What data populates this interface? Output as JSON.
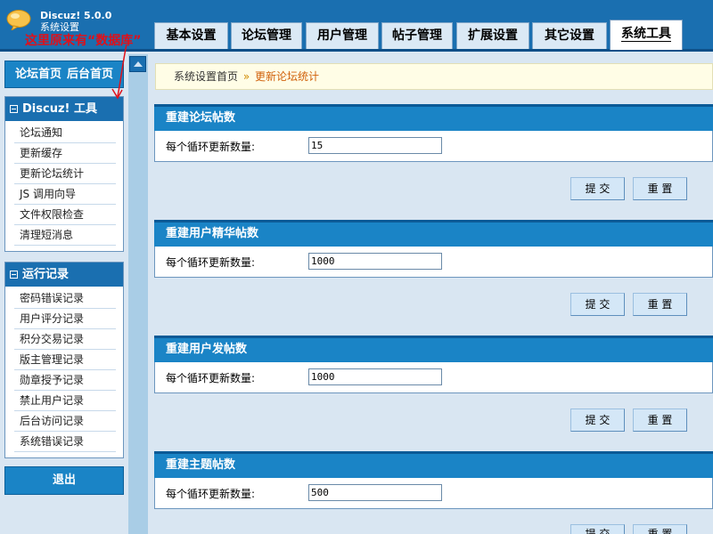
{
  "header": {
    "logo_title": "Discuz! 5.0.0",
    "logo_subtitle": "系统设置",
    "annotation": "这里原来有“数据库”",
    "tabs": [
      {
        "label": "基本设置",
        "active": false
      },
      {
        "label": "论坛管理",
        "active": false
      },
      {
        "label": "用户管理",
        "active": false
      },
      {
        "label": "帖子管理",
        "active": false
      },
      {
        "label": "扩展设置",
        "active": false
      },
      {
        "label": "其它设置",
        "active": false
      },
      {
        "label": "系统工具",
        "active": true
      }
    ]
  },
  "sidebar": {
    "top_links": {
      "forum_home": "论坛首页",
      "admin_home": "后台首页"
    },
    "tools_box": {
      "title": "Discuz! 工具",
      "items": [
        "论坛通知",
        "更新缓存",
        "更新论坛统计",
        "JS 调用向导",
        "文件权限检查",
        "清理短消息"
      ]
    },
    "logs_box": {
      "title": "运行记录",
      "items": [
        "密码错误记录",
        "用户评分记录",
        "积分交易记录",
        "版主管理记录",
        "勋章授予记录",
        "禁止用户记录",
        "后台访问记录",
        "系统错误记录"
      ]
    },
    "logout": "退出"
  },
  "breadcrumb": {
    "home": "系统设置首页",
    "separator": "»",
    "current": "更新论坛统计"
  },
  "sections": [
    {
      "title": "重建论坛帖数",
      "label": "每个循环更新数量:",
      "value": "15",
      "submit": "提 交",
      "reset": "重 置"
    },
    {
      "title": "重建用户精华帖数",
      "label": "每个循环更新数量:",
      "value": "1000",
      "submit": "提 交",
      "reset": "重 置"
    },
    {
      "title": "重建用户发帖数",
      "label": "每个循环更新数量:",
      "value": "1000",
      "submit": "提 交",
      "reset": "重 置"
    },
    {
      "title": "重建主题帖数",
      "label": "每个循环更新数量:",
      "value": "500",
      "submit": "提 交",
      "reset": "重 置"
    }
  ],
  "colors": {
    "header": "#1a6fb0",
    "annotation": "#e0101a",
    "breadcrumb_current": "#d0600a"
  }
}
